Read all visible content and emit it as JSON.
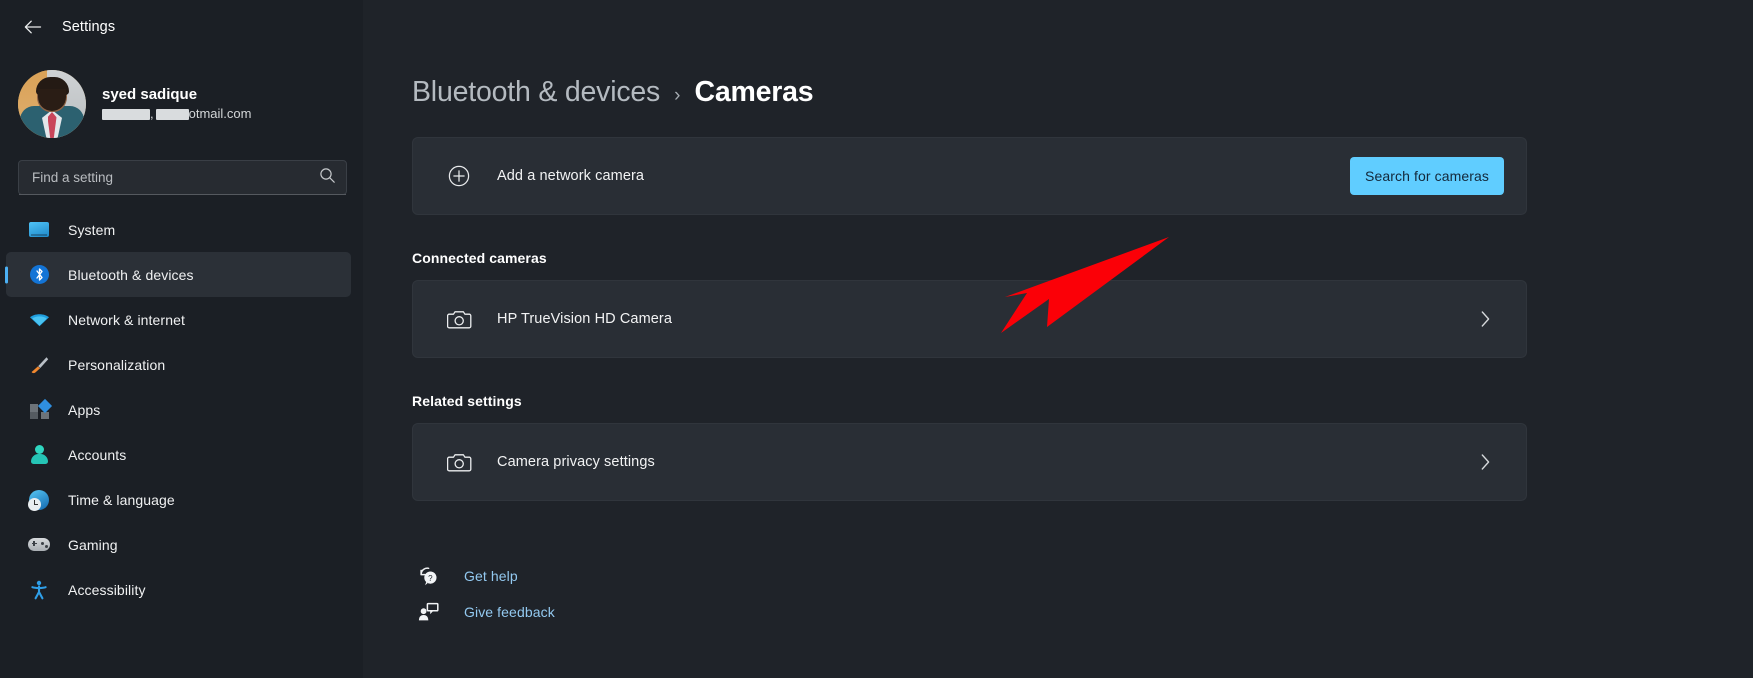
{
  "window": {
    "title": "Settings",
    "back_icon": "back-arrow-icon"
  },
  "account": {
    "name": "syed sadique",
    "email_suffix": "otmail.com",
    "email_redacted": true,
    "avatar_alt": "user-avatar"
  },
  "search": {
    "placeholder": "Find a setting",
    "value": "",
    "icon": "search-icon"
  },
  "sidebar": {
    "items": [
      {
        "label": "System",
        "icon": "monitor-icon",
        "selected": false
      },
      {
        "label": "Bluetooth & devices",
        "icon": "bluetooth-icon",
        "selected": true
      },
      {
        "label": "Network & internet",
        "icon": "wifi-icon",
        "selected": false
      },
      {
        "label": "Personalization",
        "icon": "paintbrush-icon",
        "selected": false
      },
      {
        "label": "Apps",
        "icon": "apps-grid-icon",
        "selected": false
      },
      {
        "label": "Accounts",
        "icon": "person-icon",
        "selected": false
      },
      {
        "label": "Time & language",
        "icon": "clock-globe-icon",
        "selected": false
      },
      {
        "label": "Gaming",
        "icon": "gamepad-icon",
        "selected": false
      },
      {
        "label": "Accessibility",
        "icon": "accessibility-person-icon",
        "selected": false
      }
    ]
  },
  "breadcrumb": {
    "parent": "Bluetooth & devices",
    "separator": "›",
    "current": "Cameras"
  },
  "add_camera": {
    "label": "Add a network camera",
    "icon": "plus-circle-icon",
    "button_label": "Search for cameras",
    "button_color": "#60cdff"
  },
  "connected": {
    "section_label": "Connected cameras",
    "items": [
      {
        "label": "HP TrueVision HD Camera",
        "icon": "camera-icon",
        "chevron": "chevron-right-icon"
      }
    ]
  },
  "related": {
    "section_label": "Related settings",
    "items": [
      {
        "label": "Camera privacy settings",
        "icon": "camera-icon",
        "chevron": "chevron-right-icon"
      }
    ]
  },
  "footer_links": [
    {
      "label": "Get help",
      "icon": "help-icon"
    },
    {
      "label": "Give feedback",
      "icon": "feedback-icon"
    }
  ],
  "annotation": {
    "type": "arrow",
    "color": "#fb0007",
    "points_to": "HP TrueVision HD Camera"
  }
}
